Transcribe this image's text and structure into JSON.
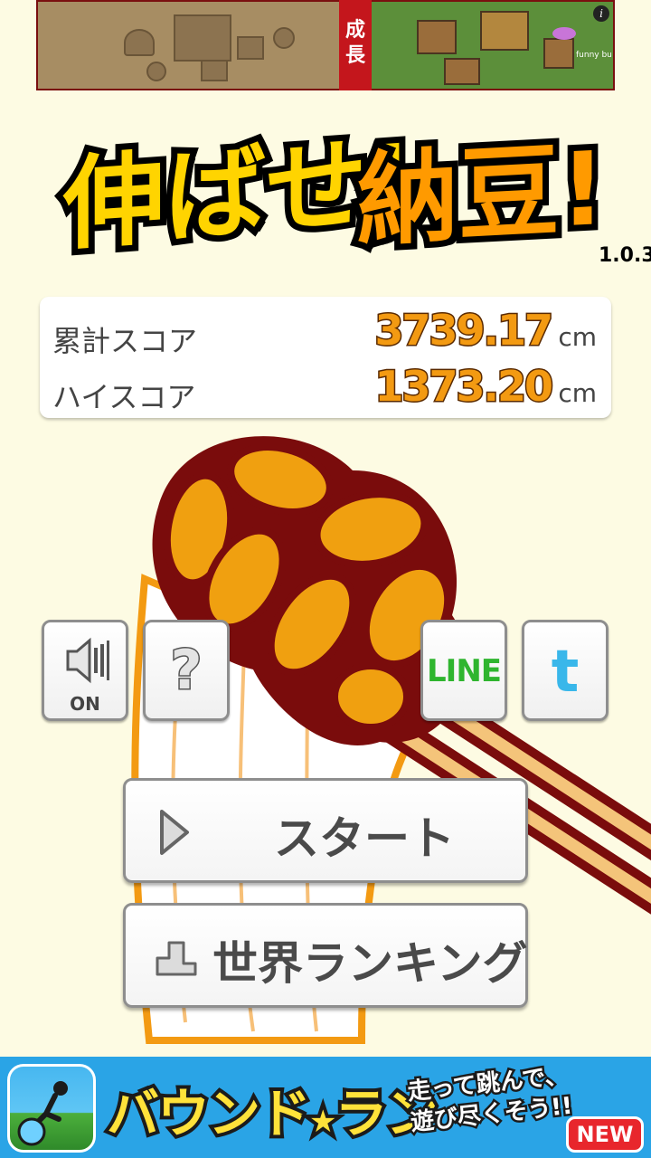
{
  "top_ad": {
    "text": "成長",
    "right_caption": "funny bu",
    "info_label": "i"
  },
  "logo": {
    "part1": "伸ばせ!",
    "part2": "納豆!",
    "version": "1.0.3"
  },
  "scores": {
    "total_label": "累計スコア",
    "total_value": "3739.17",
    "high_label": "ハイスコア",
    "high_value": "1373.20",
    "unit": "cm"
  },
  "buttons": {
    "sound_label": "ON",
    "help_label": "?",
    "line_label": "LINE",
    "twitter_label": "t",
    "start_label": "スタート",
    "ranking_label": "世界ランキング"
  },
  "bottom_ad": {
    "title_part1": "バウンド",
    "title_star": "★",
    "title_part2": "ラン",
    "tagline": "走って跳んで、遊び尽くそう!!",
    "badge": "NEW"
  },
  "colors": {
    "background": "#fdfbe3",
    "score_value": "#f39a12",
    "logo_yellow": "#ffd400",
    "logo_orange": "#ff9a00",
    "line_green": "#2fb52f",
    "twitter_blue": "#39b7ea"
  }
}
